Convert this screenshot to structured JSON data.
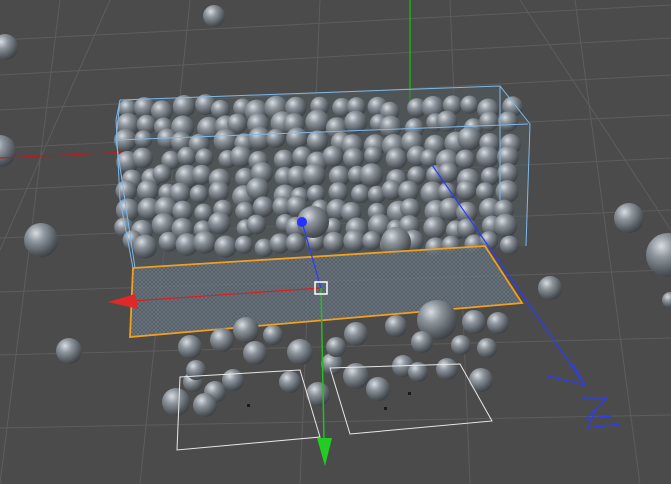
{
  "viewport": {
    "name": "3d-viewport",
    "background": "#4b4b4b",
    "grid_color": "#5d5d5d",
    "sphere_color": "#7c8288",
    "bounding_box_color": "#7fb8e8",
    "plane_highlight_color": "#f0a020"
  },
  "axes": {
    "x_color": "#e02020",
    "y_color": "#20c020",
    "z_color": "#2a3cff"
  },
  "icons": {
    "move-handle": "white-square-handle",
    "z-axis-end": "zigzag-z-glyph"
  }
}
